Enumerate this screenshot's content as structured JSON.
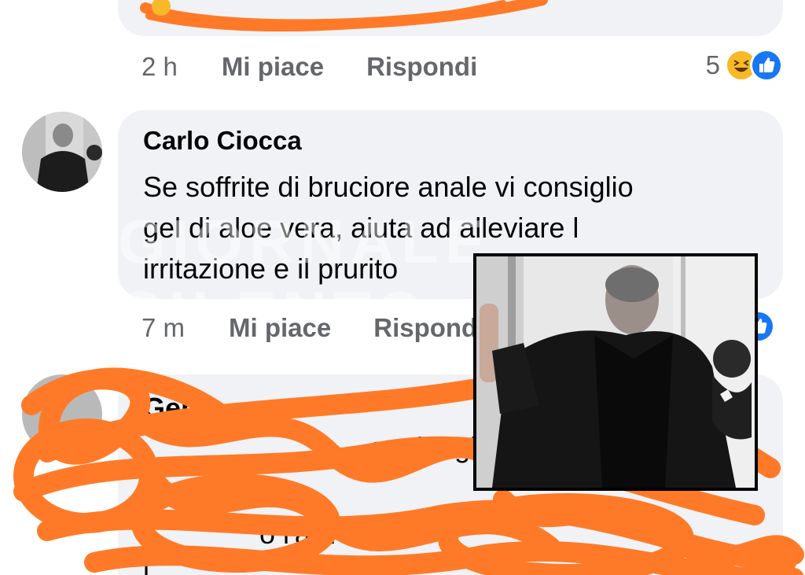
{
  "top_comment": {
    "time": "2 h",
    "like_label": "Mi piace",
    "reply_label": "Rispondi",
    "reaction_count": "5",
    "reactions": [
      "haha-icon",
      "like-icon"
    ]
  },
  "carlo_comment": {
    "author": "Carlo Ciocca",
    "text_lines": [
      "Se soffrite di bruciore anale vi consiglio",
      "gel di aloe vera, aiuta ad alleviare l",
      "irritazione e il prurito"
    ],
    "time": "7 m",
    "like_label": "Mi piace",
    "reply_label": "Rispondi"
  },
  "third_comment": {
    "author_partial": "Genn",
    "line1_partial": "aggiungi",
    "line2_partial": "o l'aut azion",
    "line3_partial": "l'"
  },
  "watermark": "GIORNALE CILENTO",
  "colors": {
    "bubble": "#f0f2f5",
    "secondary_text": "#65676b",
    "scribble": "#ff7a28",
    "like_blue": "#1877f2",
    "haha_yellow": "#f7b928"
  }
}
